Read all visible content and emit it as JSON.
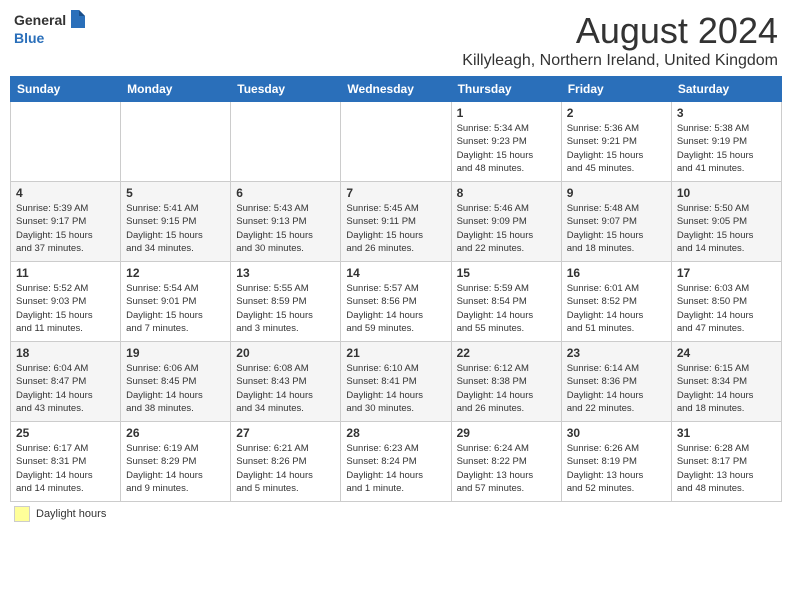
{
  "header": {
    "logo_line1": "General",
    "logo_line2": "Blue",
    "month_title": "August 2024",
    "location": "Killyleagh, Northern Ireland, United Kingdom"
  },
  "footer": {
    "daylight_label": "Daylight hours"
  },
  "days_of_week": [
    "Sunday",
    "Monday",
    "Tuesday",
    "Wednesday",
    "Thursday",
    "Friday",
    "Saturday"
  ],
  "weeks": [
    [
      {
        "day": "",
        "info": ""
      },
      {
        "day": "",
        "info": ""
      },
      {
        "day": "",
        "info": ""
      },
      {
        "day": "",
        "info": ""
      },
      {
        "day": "1",
        "info": "Sunrise: 5:34 AM\nSunset: 9:23 PM\nDaylight: 15 hours\nand 48 minutes."
      },
      {
        "day": "2",
        "info": "Sunrise: 5:36 AM\nSunset: 9:21 PM\nDaylight: 15 hours\nand 45 minutes."
      },
      {
        "day": "3",
        "info": "Sunrise: 5:38 AM\nSunset: 9:19 PM\nDaylight: 15 hours\nand 41 minutes."
      }
    ],
    [
      {
        "day": "4",
        "info": "Sunrise: 5:39 AM\nSunset: 9:17 PM\nDaylight: 15 hours\nand 37 minutes."
      },
      {
        "day": "5",
        "info": "Sunrise: 5:41 AM\nSunset: 9:15 PM\nDaylight: 15 hours\nand 34 minutes."
      },
      {
        "day": "6",
        "info": "Sunrise: 5:43 AM\nSunset: 9:13 PM\nDaylight: 15 hours\nand 30 minutes."
      },
      {
        "day": "7",
        "info": "Sunrise: 5:45 AM\nSunset: 9:11 PM\nDaylight: 15 hours\nand 26 minutes."
      },
      {
        "day": "8",
        "info": "Sunrise: 5:46 AM\nSunset: 9:09 PM\nDaylight: 15 hours\nand 22 minutes."
      },
      {
        "day": "9",
        "info": "Sunrise: 5:48 AM\nSunset: 9:07 PM\nDaylight: 15 hours\nand 18 minutes."
      },
      {
        "day": "10",
        "info": "Sunrise: 5:50 AM\nSunset: 9:05 PM\nDaylight: 15 hours\nand 14 minutes."
      }
    ],
    [
      {
        "day": "11",
        "info": "Sunrise: 5:52 AM\nSunset: 9:03 PM\nDaylight: 15 hours\nand 11 minutes."
      },
      {
        "day": "12",
        "info": "Sunrise: 5:54 AM\nSunset: 9:01 PM\nDaylight: 15 hours\nand 7 minutes."
      },
      {
        "day": "13",
        "info": "Sunrise: 5:55 AM\nSunset: 8:59 PM\nDaylight: 15 hours\nand 3 minutes."
      },
      {
        "day": "14",
        "info": "Sunrise: 5:57 AM\nSunset: 8:56 PM\nDaylight: 14 hours\nand 59 minutes."
      },
      {
        "day": "15",
        "info": "Sunrise: 5:59 AM\nSunset: 8:54 PM\nDaylight: 14 hours\nand 55 minutes."
      },
      {
        "day": "16",
        "info": "Sunrise: 6:01 AM\nSunset: 8:52 PM\nDaylight: 14 hours\nand 51 minutes."
      },
      {
        "day": "17",
        "info": "Sunrise: 6:03 AM\nSunset: 8:50 PM\nDaylight: 14 hours\nand 47 minutes."
      }
    ],
    [
      {
        "day": "18",
        "info": "Sunrise: 6:04 AM\nSunset: 8:47 PM\nDaylight: 14 hours\nand 43 minutes."
      },
      {
        "day": "19",
        "info": "Sunrise: 6:06 AM\nSunset: 8:45 PM\nDaylight: 14 hours\nand 38 minutes."
      },
      {
        "day": "20",
        "info": "Sunrise: 6:08 AM\nSunset: 8:43 PM\nDaylight: 14 hours\nand 34 minutes."
      },
      {
        "day": "21",
        "info": "Sunrise: 6:10 AM\nSunset: 8:41 PM\nDaylight: 14 hours\nand 30 minutes."
      },
      {
        "day": "22",
        "info": "Sunrise: 6:12 AM\nSunset: 8:38 PM\nDaylight: 14 hours\nand 26 minutes."
      },
      {
        "day": "23",
        "info": "Sunrise: 6:14 AM\nSunset: 8:36 PM\nDaylight: 14 hours\nand 22 minutes."
      },
      {
        "day": "24",
        "info": "Sunrise: 6:15 AM\nSunset: 8:34 PM\nDaylight: 14 hours\nand 18 minutes."
      }
    ],
    [
      {
        "day": "25",
        "info": "Sunrise: 6:17 AM\nSunset: 8:31 PM\nDaylight: 14 hours\nand 14 minutes."
      },
      {
        "day": "26",
        "info": "Sunrise: 6:19 AM\nSunset: 8:29 PM\nDaylight: 14 hours\nand 9 minutes."
      },
      {
        "day": "27",
        "info": "Sunrise: 6:21 AM\nSunset: 8:26 PM\nDaylight: 14 hours\nand 5 minutes."
      },
      {
        "day": "28",
        "info": "Sunrise: 6:23 AM\nSunset: 8:24 PM\nDaylight: 14 hours\nand 1 minute."
      },
      {
        "day": "29",
        "info": "Sunrise: 6:24 AM\nSunset: 8:22 PM\nDaylight: 13 hours\nand 57 minutes."
      },
      {
        "day": "30",
        "info": "Sunrise: 6:26 AM\nSunset: 8:19 PM\nDaylight: 13 hours\nand 52 minutes."
      },
      {
        "day": "31",
        "info": "Sunrise: 6:28 AM\nSunset: 8:17 PM\nDaylight: 13 hours\nand 48 minutes."
      }
    ]
  ]
}
